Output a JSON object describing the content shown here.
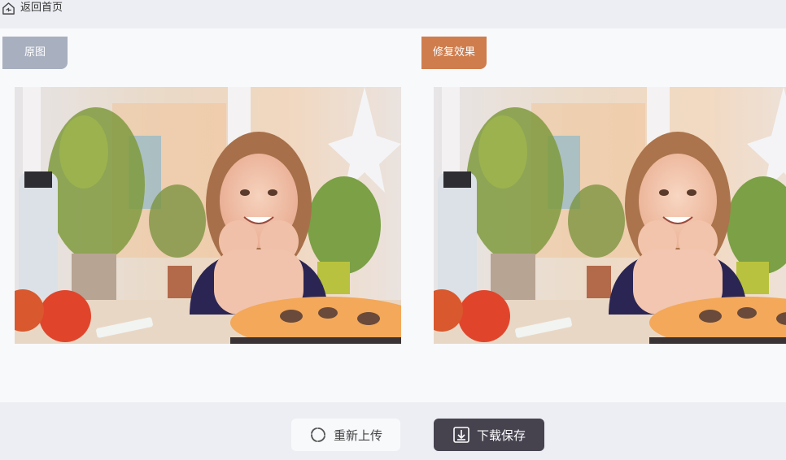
{
  "nav": {
    "back_label": "返回首页",
    "back_icon": "home-return-icon"
  },
  "panels": {
    "original_label": "原图",
    "restored_label": "修复效果"
  },
  "actions": {
    "reupload_label": "重新上传",
    "reupload_icon": "refresh-icon",
    "download_label": "下载保存",
    "download_icon": "download-icon"
  },
  "colors": {
    "original_tag": "#a8afbf",
    "restored_tag": "#cf7d4d",
    "download_button": "#46434f",
    "page_background": "#eceef3",
    "content_background": "#f8f9fa"
  }
}
